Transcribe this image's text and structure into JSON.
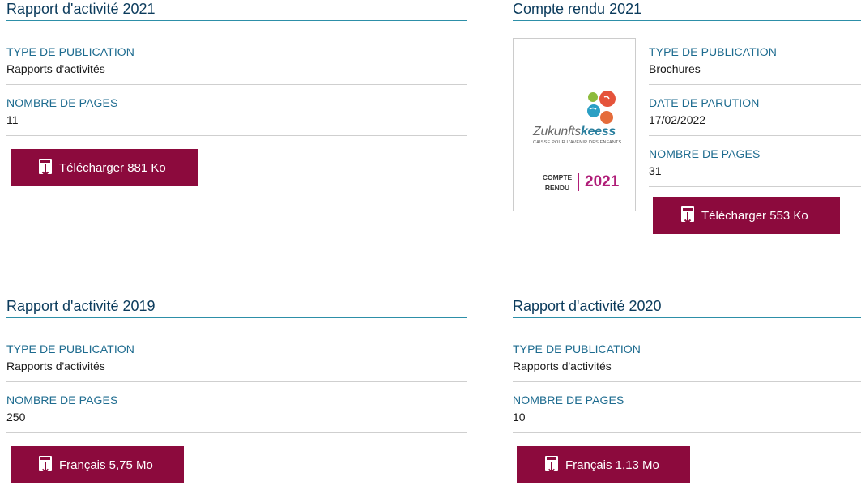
{
  "cards": [
    {
      "title": "Rapport d'activité 2021",
      "fields": [
        {
          "label": "TYPE DE PUBLICATION",
          "value": "Rapports d'activités"
        },
        {
          "label": "NOMBRE DE PAGES",
          "value": "11"
        }
      ],
      "button": "Télécharger 881 Ko"
    },
    {
      "title": "Compte rendu 2021",
      "thumbnail": {
        "logo_part1": "Zukunfts",
        "logo_part2": "keess",
        "logo_sub": "CAISSE POUR L'AVENIR DES ENFANTS",
        "label_line1": "COMPTE",
        "label_line2": "RENDU",
        "year": "2021"
      },
      "fields": [
        {
          "label": "TYPE DE PUBLICATION",
          "value": "Brochures"
        },
        {
          "label": "DATE DE PARUTION",
          "value": "17/02/2022"
        },
        {
          "label": "NOMBRE DE PAGES",
          "value": "31"
        }
      ],
      "button": "Télécharger 553 Ko"
    },
    {
      "title": "Rapport d'activité 2019",
      "fields": [
        {
          "label": "TYPE DE PUBLICATION",
          "value": "Rapports d'activités"
        },
        {
          "label": "NOMBRE DE PAGES",
          "value": "250"
        }
      ],
      "button": "Français 5,75 Mo"
    },
    {
      "title": "Rapport d'activité 2020",
      "fields": [
        {
          "label": "TYPE DE PUBLICATION",
          "value": "Rapports d'activités"
        },
        {
          "label": "NOMBRE DE PAGES",
          "value": "10"
        }
      ],
      "button": "Français 1,13 Mo"
    }
  ],
  "colors": {
    "title": "#0b3b5c",
    "label": "#1d6b8f",
    "button_bg": "#8c0a3d",
    "title_rule": "#2d8fa8"
  },
  "icons": {
    "download": "download-document-icon"
  }
}
